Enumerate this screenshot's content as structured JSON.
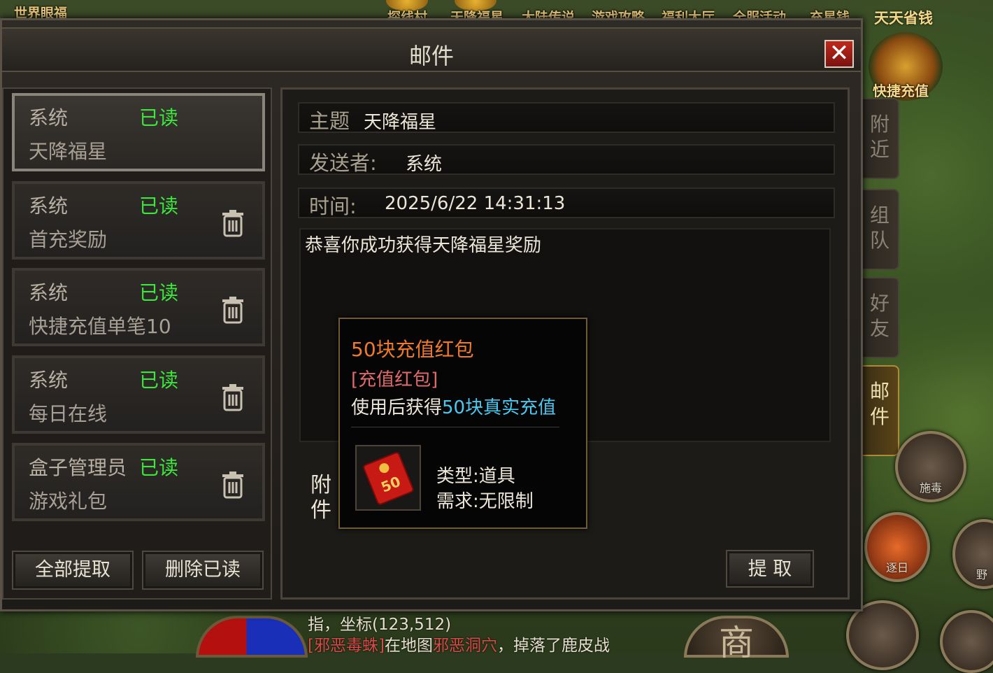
{
  "top_bar": {
    "left_label": "世界眼福",
    "items": [
      "探线村",
      "天降福星",
      "大陆传说",
      "游戏攻略",
      "福利大厅",
      "全服活动",
      "充星钱"
    ],
    "save_money": "天天省钱",
    "fast_charge": "快捷充值"
  },
  "window": {
    "title": "邮件",
    "close_label": "✕"
  },
  "mail_list": [
    {
      "sender": "系统",
      "status": "已读",
      "subject": "天降福星",
      "selected": true
    },
    {
      "sender": "系统",
      "status": "已读",
      "subject": "首充奖励"
    },
    {
      "sender": "系统",
      "status": "已读",
      "subject": "快捷充值单笔10"
    },
    {
      "sender": "系统",
      "status": "已读",
      "subject": "每日在线"
    },
    {
      "sender": "盒子管理员",
      "status": "已读",
      "subject": "游戏礼包"
    }
  ],
  "list_buttons": {
    "collect_all": "全部提取",
    "delete_read": "删除已读"
  },
  "detail": {
    "subject_label": "主题",
    "subject_value": "天降福星",
    "sender_label": "发送者:",
    "sender_value": "系统",
    "time_label": "时间:",
    "time_value": "2025/6/22 14:31:13",
    "content": "恭喜你成功获得天降福星奖励",
    "attachment_label": "附件",
    "collect_button": "提 取"
  },
  "tooltip": {
    "item_name": "50块充值红包",
    "item_type": "[充值红包]",
    "desc_prefix": "使用后获得",
    "desc_highlight": "50块真实充值",
    "type_label": "类型:",
    "type_value": "道具",
    "require_label": "需求:",
    "require_value": "无限制",
    "icon_text": "50"
  },
  "side_tabs": [
    {
      "label": "附近"
    },
    {
      "label": "组队"
    },
    {
      "label": "好友"
    },
    {
      "label": "邮件",
      "active": true
    }
  ],
  "skills": [
    "施毒",
    "逐日",
    "野"
  ],
  "chat": {
    "line1": "指，坐标(123,512)",
    "line2_name": "[邪恶毒蛛]",
    "line2_mid": "在地图",
    "line2_map": "邪恶洞穴",
    "line2_end": "，掉落了鹿皮战"
  },
  "shop_label": "商",
  "colors": {
    "read_status": "#3ce63c",
    "item_name": "#f07a2a",
    "highlight": "#4ac8f0",
    "close_red": "#c0281c"
  }
}
